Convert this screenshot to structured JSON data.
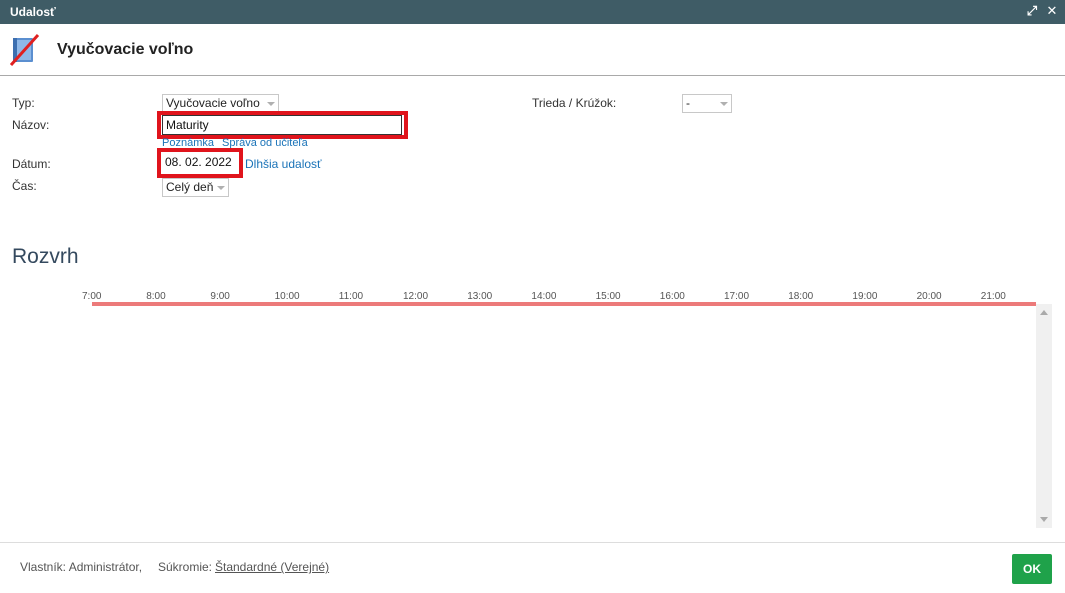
{
  "window": {
    "title": "Udalosť",
    "maximize_icon": "⤢",
    "close_icon": "✕"
  },
  "header": {
    "heading": "Vyučovacie voľno",
    "icon": "book-crossed-icon"
  },
  "form": {
    "type_label": "Typ:",
    "type_value": "Vyučovacie voľno",
    "name_label": "Názov:",
    "name_value": "Maturity",
    "note_link": "Poznámka",
    "teacher_message_link": "Správa od učiteľa",
    "date_label": "Dátum:",
    "date_value": "08. 02. 2022",
    "longer_event_link": "Dlhšia udalosť",
    "time_label": "Čas:",
    "time_value": "Celý deň",
    "class_label": "Trieda / Krúžok:",
    "class_value": "-"
  },
  "schedule": {
    "title": "Rozvrh",
    "hours": [
      "7:00",
      "8:00",
      "9:00",
      "10:00",
      "11:00",
      "12:00",
      "13:00",
      "14:00",
      "15:00",
      "16:00",
      "17:00",
      "18:00",
      "19:00",
      "20:00",
      "21:00"
    ]
  },
  "footer": {
    "owner_text": "Vlastník: Administrátor,",
    "privacy_label": "Súkromie:",
    "privacy_value": "Štandardné (Verejné)",
    "ok_label": "OK"
  },
  "colors": {
    "titlebar": "#3f5c66",
    "highlight": "#e0141c",
    "timeline_line": "#ec7a7a",
    "ok_button": "#1fa24a",
    "link": "#1a73b8"
  }
}
